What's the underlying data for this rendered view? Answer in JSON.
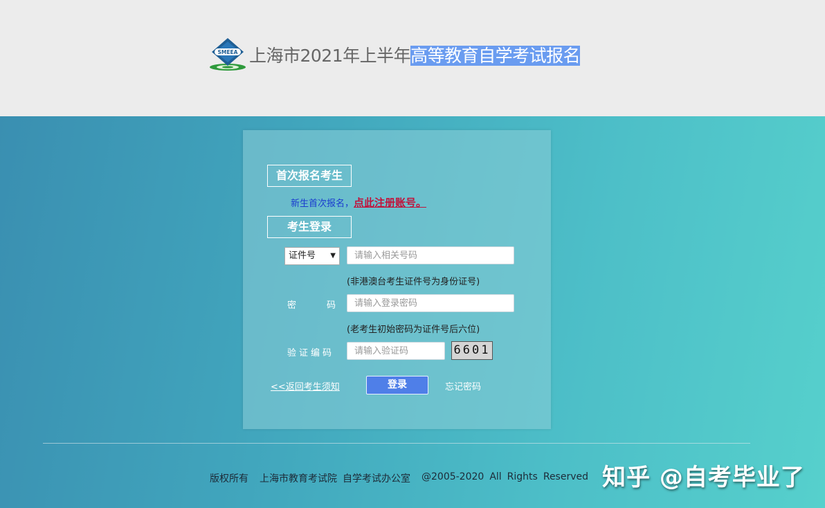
{
  "header": {
    "title_plain": "上海市2021年上半年",
    "title_highlight": "高等教育自学考试报名",
    "logo_text": "SMEEA"
  },
  "panel": {
    "first_time_heading": "首次报名考生",
    "register_prefix": "新生首次报名，",
    "register_link": "点此注册账号。",
    "login_heading": "考生登录",
    "id_type_select": "证件号",
    "id_input_placeholder": "请输入相关号码",
    "id_hint": "(非港澳台考生证件号为身份证号)",
    "password_label_left": "密",
    "password_label_right": "码",
    "password_placeholder": "请输入登录密码",
    "password_hint": "(老考生初始密码为证件号后六位)",
    "captcha_label": "验证编码",
    "captcha_placeholder": "请输入验证码",
    "captcha_image_text": "6601",
    "back_link": "<<返回考生须知",
    "login_button": "登录",
    "forgot_link": "忘记密码"
  },
  "footer": {
    "copyright": "版权所有",
    "org": "上海市教育考试院",
    "office": "自学考试办公室",
    "years": "@2005-2020",
    "rights1": "All",
    "rights2": "Rights",
    "rights3": "Reserved"
  },
  "watermark": "知乎 @自考毕业了",
  "colors": {
    "header_bg": "#ececec",
    "gradient_start": "#3a8fb1",
    "gradient_end": "#56d0cc",
    "highlight": "#6a9cf0",
    "register_link": "#c0143c",
    "login_button": "#4f7fe8"
  }
}
